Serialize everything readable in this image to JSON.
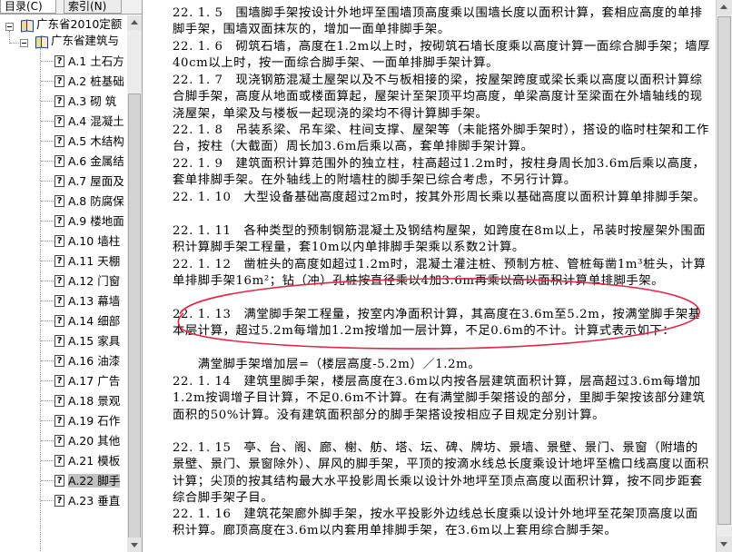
{
  "tabs": {
    "contents": "目录(C)",
    "index": "索引(N)"
  },
  "tree": {
    "root": "广东省2010定额",
    "child": "广东省建筑与",
    "items": [
      {
        "code": "A.1",
        "title": "土石方"
      },
      {
        "code": "A.2",
        "title": "桩基础"
      },
      {
        "code": "A.3",
        "title": "砌 筑"
      },
      {
        "code": "A.4",
        "title": "混凝土"
      },
      {
        "code": "A.5",
        "title": "木结构"
      },
      {
        "code": "A.6",
        "title": "金属结"
      },
      {
        "code": "A.7",
        "title": "屋面及"
      },
      {
        "code": "A.8",
        "title": "防腐保"
      },
      {
        "code": "A.9",
        "title": "楼地面"
      },
      {
        "code": "A.10",
        "title": "墙柱"
      },
      {
        "code": "A.11",
        "title": "天棚"
      },
      {
        "code": "A.12",
        "title": "门窗"
      },
      {
        "code": "A.13",
        "title": "幕墙"
      },
      {
        "code": "A.14",
        "title": "细部"
      },
      {
        "code": "A.15",
        "title": "家具"
      },
      {
        "code": "A.16",
        "title": "油漆"
      },
      {
        "code": "A.17",
        "title": "广告"
      },
      {
        "code": "A.18",
        "title": "景观"
      },
      {
        "code": "A.19",
        "title": "石作"
      },
      {
        "code": "A.20",
        "title": "其他"
      },
      {
        "code": "A.21",
        "title": "模板"
      },
      {
        "code": "A.22",
        "title": "脚手"
      },
      {
        "code": "A.23",
        "title": "垂直"
      }
    ],
    "selected_index": 21
  },
  "paragraphs": [
    "22. 1. 5　围墙脚手架按设计外地坪至围墙顶高度乘以围墙长度以面积计算，套相应高度的单排脚手架，围墙双面抹灰的，增加一面单排脚手架。",
    "22. 1. 6　砌筑石墙，高度在1.2m以上时，按砌筑石墙长度乘以高度计算一面综合脚手架；墙厚40cm以上时，按一面综合脚手架、一面单排脚手架计算。",
    "22. 1. 7　现浇钢筋混凝土屋架以及不与板相接的梁，按屋架跨度或梁长乘以高度以面积计算综合脚手架，高度从地面或楼面算起，屋架计至架顶平均高度，单梁高度计至梁面在外墙轴线的现浇屋架，单梁及与楼板一起现浇的梁均不得计算脚手架。",
    "22. 1. 8　吊装系梁、吊车梁、柱间支撑、屋架等（未能搭外脚手架时），搭设的临时柱架和工作台，按柱（大截面）周长加3.6m后乘以高，套单排脚手架计算。",
    "22. 1. 9　建筑面积计算范围外的独立柱，柱高超过1.2m时，按柱身周长加3.6m后乘以高度，套单排脚手架。在外轴线上的附墙柱的脚手架已综合考虑，不另行计算。",
    "22. 1. 10　大型设备基础高度超过2m时，按其外形周长乘以基础高度以面积计算单排脚手架。",
    "22. 1. 11　各种类型的预制钢筋混凝土及钢结构屋架，如跨度在8m以上，吊装时按屋架外围面积计算脚手架工程量，套10m以内单排脚手架乘以系数2计算。",
    "22. 1. 12　凿桩头的高度如超过1.2m时，混凝土灌注桩、预制方桩、管桩每凿1m³桩头，计算单排脚手架16m²；钻（冲）孔桩按直径乘以4加3.6m再乘以高以面积计算单排脚手架。",
    "22. 1. 13　满堂脚手架工程量，按室内净面积计算，其高度在3.6m至5.2m，按满堂脚手架基本层计算，超过5.2m每增加1.2m按增加一层计算，不足0.6m的不计。计算式表示如下：",
    "　　满堂脚手架增加层=（楼层高度-5.2m）／1.2m。",
    "22. 1. 14　建筑里脚手架，楼层高度在3.6m以内按各层建筑面积计算，层高超过3.6m每增加1.2m按调增子目计算，不足0.6m不计算。在有满堂脚手架搭设的部分，里脚手架按该部分建筑面积的50%计算。没有建筑面积部分的脚手架搭设按相应子目规定分别计算。",
    "22. 1. 15　亭、台、阁、廊、榭、舫、塔、坛、碑、牌坊、景墙、景壁、景门、景窗（附墙的景壁、景门、景窗除外）、屏风的脚手架，平顶的按滴水线总长度乘设计地坪至檐口线高度以面积计算；尖顶的按其结构最大水平投影周长乘以设计外地坪至顶点高度以面积计算，按不同步距套综合脚手架子目。",
    "22. 1. 16　建筑花架廊外脚手架，按水平投影外边线总长度乘以设计外地坪至花架顶高度以面积计算。廊顶高度在3.6m以内套用单排脚手架，在3.6m以上套用综合脚手架。"
  ],
  "colors": {
    "annotation_ellipse": "#e0284a",
    "selection": "#c0c0c0"
  }
}
